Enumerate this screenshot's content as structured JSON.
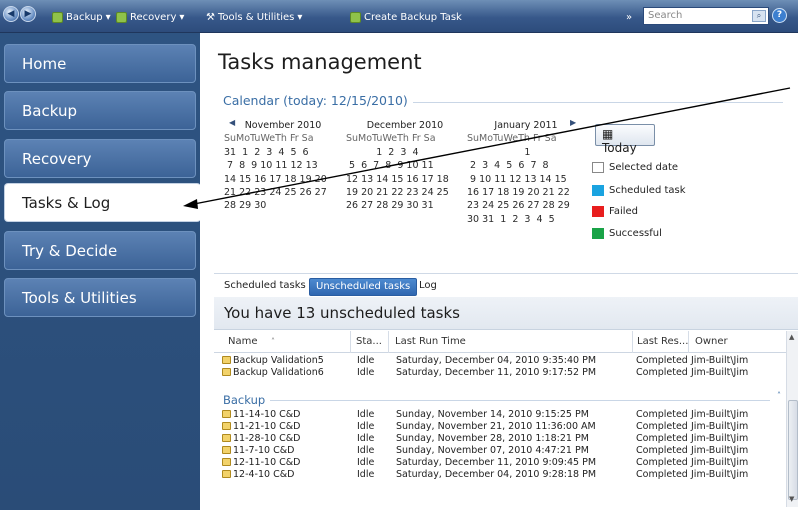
{
  "toolbar": {
    "backup_label": "Backup",
    "recovery_label": "Recovery",
    "tools_label": "Tools & Utilities",
    "create_task_label": "Create Backup Task",
    "search_placeholder": "Search",
    "overflow": "»"
  },
  "sidebar": {
    "items": [
      {
        "label": "Home"
      },
      {
        "label": "Backup"
      },
      {
        "label": "Recovery"
      },
      {
        "label": "Tasks & Log"
      },
      {
        "label": "Try & Decide"
      },
      {
        "label": "Tools & Utilities"
      }
    ]
  },
  "main": {
    "title": "Tasks management",
    "calendar_heading": "Calendar (today: 12/15/2010)",
    "months": [
      {
        "name": "November 2010",
        "dow": "SuMoTuWeTh Fr Sa",
        "weeks": [
          "31  1  2  3  4  5  6",
          " 7  8  9 10 11 12 13",
          "14 15 16 17 18 19 20",
          "21 22 23 24 25 26 27",
          "28 29 30"
        ]
      },
      {
        "name": "December 2010",
        "dow": "SuMoTuWeTh Fr Sa",
        "weeks": [
          "          1  2  3  4",
          " 5  6  7  8  9 10 11",
          "12 13 14 15 16 17 18",
          "19 20 21 22 23 24 25",
          "26 27 28 29 30 31"
        ]
      },
      {
        "name": "January 2011",
        "dow": "SuMoTuWeTh Fr Sa",
        "weeks": [
          "                   1",
          " 2  3  4  5  6  7  8",
          " 9 10 11 12 13 14 15",
          "16 17 18 19 20 21 22",
          "23 24 25 26 27 28 29",
          "30 31  1  2  3  4  5"
        ]
      }
    ],
    "today_button": "Today",
    "legend": [
      {
        "label": "Selected date",
        "color": "#ffffff"
      },
      {
        "label": "Scheduled task",
        "color": "#1aa3e0"
      },
      {
        "label": "Failed",
        "color": "#e81e1e"
      },
      {
        "label": "Successful",
        "color": "#19a347"
      }
    ],
    "tabs": [
      "Scheduled tasks",
      "Unscheduled tasks",
      "Log"
    ],
    "subheading": "You have 13 unscheduled tasks",
    "columns": [
      "Name",
      "Sta...",
      "Last Run Time",
      "Last Res...",
      "Owner"
    ],
    "rows_top": [
      {
        "name": "Backup Validation5",
        "status": "Idle",
        "time": "Saturday, December 04, 2010 9:35:40 PM",
        "result": "Completed",
        "owner": "Jim-Built\\Jim"
      },
      {
        "name": "Backup Validation6",
        "status": "Idle",
        "time": "Saturday, December 11, 2010 9:17:52 PM",
        "result": "Completed",
        "owner": "Jim-Built\\Jim"
      }
    ],
    "group_label": "Backup",
    "rows_backup": [
      {
        "name": "11-14-10 C&D",
        "status": "Idle",
        "time": "Sunday, November 14, 2010 9:15:25 PM",
        "result": "Completed",
        "owner": "Jim-Built\\Jim"
      },
      {
        "name": "11-21-10 C&D",
        "status": "Idle",
        "time": "Sunday, November 21, 2010 11:36:00 AM",
        "result": "Completed",
        "owner": "Jim-Built\\Jim"
      },
      {
        "name": "11-28-10 C&D",
        "status": "Idle",
        "time": "Sunday, November 28, 2010 1:18:21 PM",
        "result": "Completed",
        "owner": "Jim-Built\\Jim"
      },
      {
        "name": "11-7-10 C&D",
        "status": "Idle",
        "time": "Sunday, November 07, 2010 4:47:21 PM",
        "result": "Completed",
        "owner": "Jim-Built\\Jim"
      },
      {
        "name": "12-11-10 C&D",
        "status": "Idle",
        "time": "Saturday, December 11, 2010 9:09:45 PM",
        "result": "Completed",
        "owner": "Jim-Built\\Jim"
      },
      {
        "name": "12-4-10 C&D",
        "status": "Idle",
        "time": "Saturday, December 04, 2010 9:28:18 PM",
        "result": "Completed",
        "owner": "Jim-Built\\Jim"
      }
    ]
  }
}
